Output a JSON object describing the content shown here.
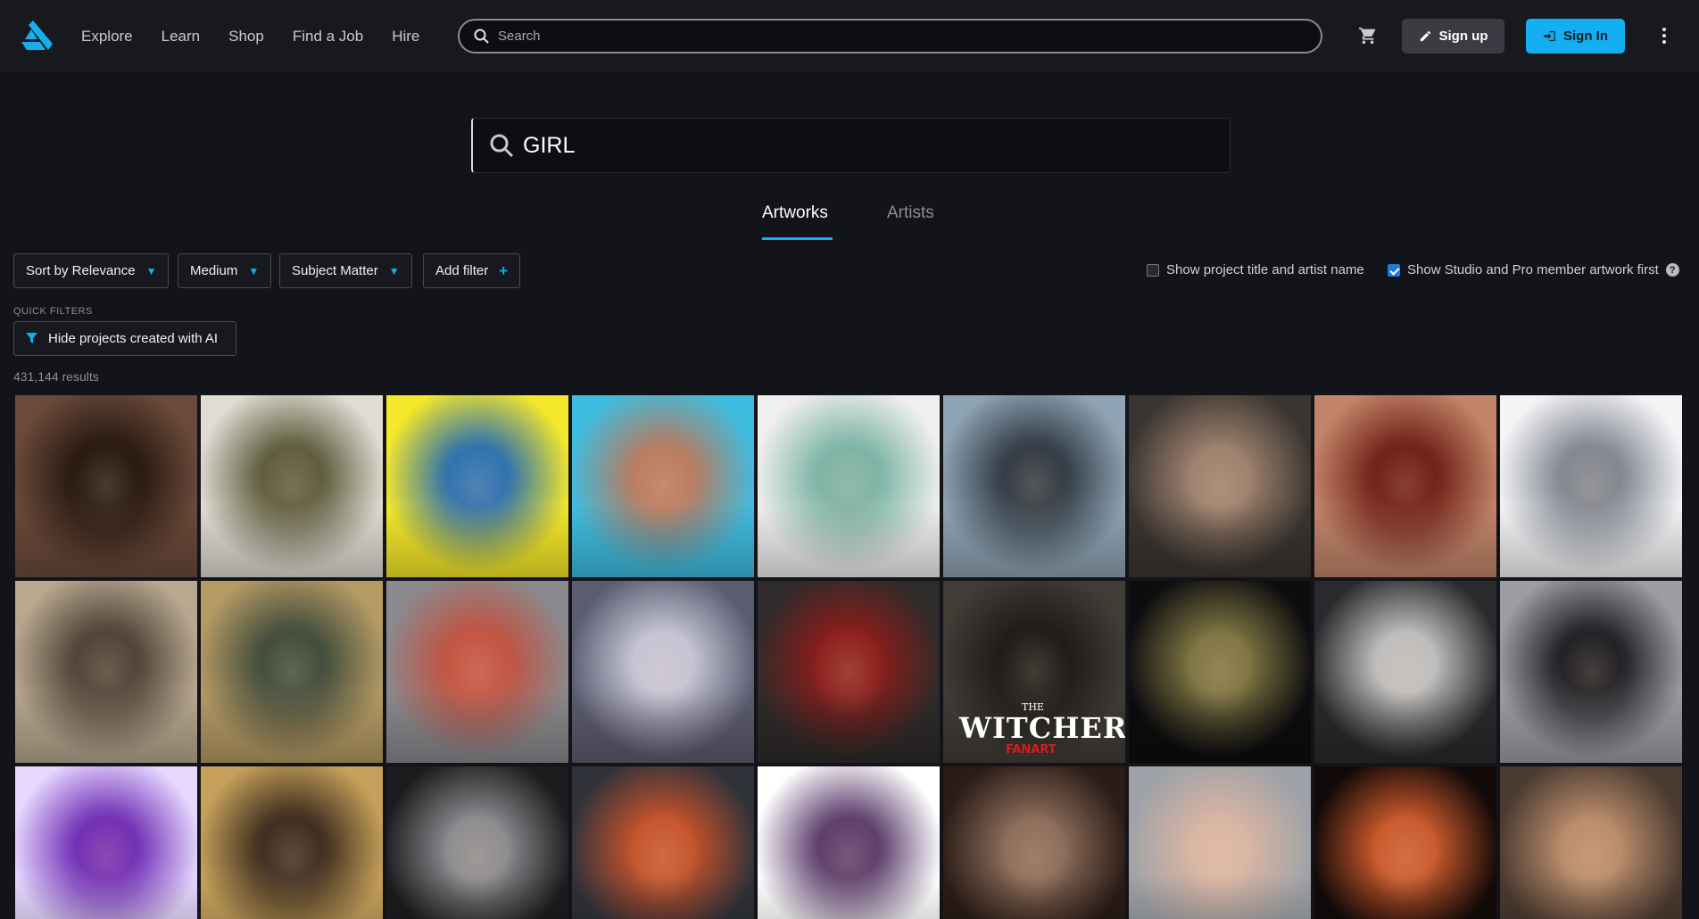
{
  "nav": {
    "items": [
      "Explore",
      "Learn",
      "Shop",
      "Find a Job",
      "Hire"
    ]
  },
  "top_search": {
    "placeholder": "Search"
  },
  "buttons": {
    "signup": "Sign up",
    "signin": "Sign In"
  },
  "main_search": {
    "value": "GIRL"
  },
  "tabs": {
    "artworks": "Artworks",
    "artists": "Artists"
  },
  "filters": {
    "sort": "Sort by Relevance",
    "medium": "Medium",
    "subject": "Subject Matter",
    "add": "Add filter"
  },
  "options": {
    "show_title": "Show project title and artist name",
    "show_title_checked": false,
    "studio_first": "Show Studio and Pro member artwork first",
    "studio_first_checked": true
  },
  "quick_filters": {
    "label": "QUICK FILTERS",
    "hide_ai": "Hide projects created with AI"
  },
  "results": {
    "count": "431,144 results"
  },
  "colors": {
    "accent": "#13aff0",
    "topbar": "#18181f",
    "background": "#13131a"
  },
  "artworks": [
    {
      "name": "portrait-brunette-freckles",
      "c1": "#6b4a3a",
      "c2": "#24160f"
    },
    {
      "name": "armored-woman-desert",
      "c1": "#e0dcd4",
      "c2": "#5c5a3a"
    },
    {
      "name": "cyberpunk-rainbow-hair",
      "c1": "#f5e82a",
      "c2": "#2a6fb0"
    },
    {
      "name": "pink-hair-neon-makeup",
      "c1": "#3fbde0",
      "c2": "#b87a5e"
    },
    {
      "name": "samurai-girl-sketch",
      "c1": "#f0efed",
      "c2": "#7ab3a4"
    },
    {
      "name": "girl-city-rooftop",
      "c1": "#8ea3b3",
      "c2": "#2f3842"
    },
    {
      "name": "bob-hair-realistic",
      "c1": "#3a3531",
      "c2": "#9c7f6c"
    },
    {
      "name": "short-hair-red-scarf",
      "c1": "#c2856a",
      "c2": "#6e1d14"
    },
    {
      "name": "ink-samurai-woman",
      "c1": "#f4f4f6",
      "c2": "#7f8590"
    },
    {
      "name": "blonde-warrior-close",
      "c1": "#b8a890",
      "c2": "#4c4035"
    },
    {
      "name": "ornate-helmet-woman",
      "c1": "#b59a64",
      "c2": "#3e4a3a"
    },
    {
      "name": "cartoon-kids-trio",
      "c1": "#8a8a8e",
      "c2": "#c2513f"
    },
    {
      "name": "white-hair-stylized",
      "c1": "#5c5c70",
      "c2": "#c4c4d6"
    },
    {
      "name": "red-motorbike-night",
      "c1": "#2e2b2a",
      "c2": "#8b1d1a"
    },
    {
      "name": "witcher-fanart",
      "c1": "#413c36",
      "c2": "#1b1917"
    },
    {
      "name": "creature-sculpt",
      "c1": "#0d0d0f",
      "c2": "#7c7240"
    },
    {
      "name": "stone-sculpture-embrace",
      "c1": "#2a2a2c",
      "c2": "#bdbdbd"
    },
    {
      "name": "masked-dark-figure",
      "c1": "#9c9ca3",
      "c2": "#1c1c20"
    },
    {
      "name": "purple-oni-girl",
      "c1": "#e6d8ff",
      "c2": "#6f2bb3"
    },
    {
      "name": "golden-hat-portrait",
      "c1": "#c7a15b",
      "c2": "#3a2a1c"
    },
    {
      "name": "thorn-crown-sculpt",
      "c1": "#1c1c1e",
      "c2": "#8a8a8e"
    },
    {
      "name": "soldier-garage",
      "c1": "#30323a",
      "c2": "#c4522a"
    },
    {
      "name": "anime-girl-purple-coat",
      "c1": "#ffffff",
      "c2": "#5a3a6a"
    },
    {
      "name": "dark-hair-realistic",
      "c1": "#2a1c17",
      "c2": "#8a6a58"
    },
    {
      "name": "blue-eyes-stylized",
      "c1": "#9ea2a8",
      "c2": "#d8b4a2"
    },
    {
      "name": "fire-spirit",
      "c1": "#120a08",
      "c2": "#c8582a"
    },
    {
      "name": "victorian-woman",
      "c1": "#4a3a30",
      "c2": "#b88a6a"
    }
  ],
  "witcher_text": {
    "title": "WITCHER",
    "small": "THE",
    "sub": "FANART"
  }
}
